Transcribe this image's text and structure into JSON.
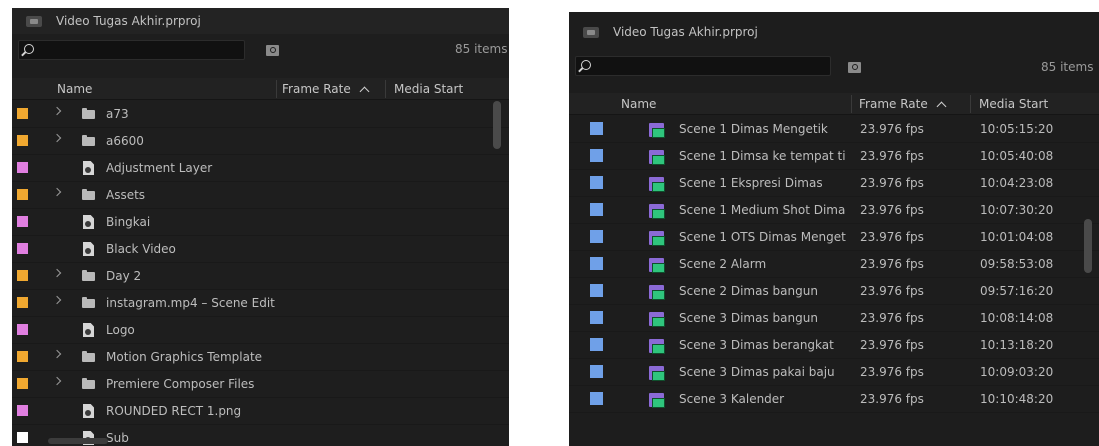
{
  "left_panel": {
    "project_title": "Video Tugas Akhir.prproj",
    "search": {
      "value": "",
      "placeholder": ""
    },
    "item_count": "85 items",
    "columns": {
      "name": "Name",
      "frame_rate": "Frame Rate",
      "media_start": "Media Start"
    },
    "rows": [
      {
        "label": "a73",
        "color": "#f0a830",
        "type": "folder",
        "expandable": true
      },
      {
        "label": "a6600",
        "color": "#f0a830",
        "type": "folder",
        "expandable": true
      },
      {
        "label": "Adjustment Layer",
        "color": "#e07fe0",
        "type": "file",
        "expandable": false
      },
      {
        "label": "Assets",
        "color": "#f0a830",
        "type": "folder",
        "expandable": true
      },
      {
        "label": "Bingkai",
        "color": "#e07fe0",
        "type": "file",
        "expandable": false
      },
      {
        "label": "Black Video",
        "color": "#e07fe0",
        "type": "file",
        "expandable": false
      },
      {
        "label": "Day 2",
        "color": "#f0a830",
        "type": "folder",
        "expandable": true
      },
      {
        "label": "instagram.mp4 – Scene Edit",
        "color": "#f0a830",
        "type": "folder",
        "expandable": true
      },
      {
        "label": "Logo",
        "color": "#e07fe0",
        "type": "file",
        "expandable": false
      },
      {
        "label": "Motion Graphics Template",
        "color": "#f0a830",
        "type": "folder",
        "expandable": true
      },
      {
        "label": "Premiere Composer Files",
        "color": "#f0a830",
        "type": "folder",
        "expandable": true
      },
      {
        "label": "ROUNDED RECT 1.png",
        "color": "#e07fe0",
        "type": "file",
        "expandable": false
      },
      {
        "label": "Sub",
        "color": "#ffffff",
        "type": "file",
        "expandable": false
      }
    ]
  },
  "right_panel": {
    "project_title": "Video Tugas Akhir.prproj",
    "search": {
      "value": "",
      "placeholder": ""
    },
    "item_count": "85 items",
    "columns": {
      "name": "Name",
      "frame_rate": "Frame Rate",
      "media_start": "Media Start"
    },
    "rows": [
      {
        "label": "Scene 1 Dimas Mengetik",
        "frame_rate": "23.976 fps",
        "media_start": "10:05:15:20",
        "color": "#6fa0e8"
      },
      {
        "label": "Scene 1 Dimsa ke tempat ti",
        "frame_rate": "23.976 fps",
        "media_start": "10:05:40:08",
        "color": "#6fa0e8"
      },
      {
        "label": "Scene 1 Ekspresi Dimas",
        "frame_rate": "23.976 fps",
        "media_start": "10:04:23:08",
        "color": "#6fa0e8"
      },
      {
        "label": "Scene 1 Medium Shot Dima",
        "frame_rate": "23.976 fps",
        "media_start": "10:07:30:20",
        "color": "#6fa0e8"
      },
      {
        "label": "Scene 1 OTS Dimas Menget",
        "frame_rate": "23.976 fps",
        "media_start": "10:01:04:08",
        "color": "#6fa0e8"
      },
      {
        "label": "Scene 2 Alarm",
        "frame_rate": "23.976 fps",
        "media_start": "09:58:53:08",
        "color": "#6fa0e8"
      },
      {
        "label": "Scene 2 Dimas bangun",
        "frame_rate": "23.976 fps",
        "media_start": "09:57:16:20",
        "color": "#6fa0e8"
      },
      {
        "label": "Scene 3 Dimas bangun",
        "frame_rate": "23.976 fps",
        "media_start": "10:08:14:08",
        "color": "#6fa0e8"
      },
      {
        "label": "Scene 3 Dimas berangkat",
        "frame_rate": "23.976 fps",
        "media_start": "10:13:18:20",
        "color": "#6fa0e8"
      },
      {
        "label": "Scene 3 Dimas pakai baju",
        "frame_rate": "23.976 fps",
        "media_start": "10:09:03:20",
        "color": "#6fa0e8"
      },
      {
        "label": "Scene 3 Kalender",
        "frame_rate": "23.976 fps",
        "media_start": "10:10:48:20",
        "color": "#6fa0e8"
      }
    ]
  }
}
